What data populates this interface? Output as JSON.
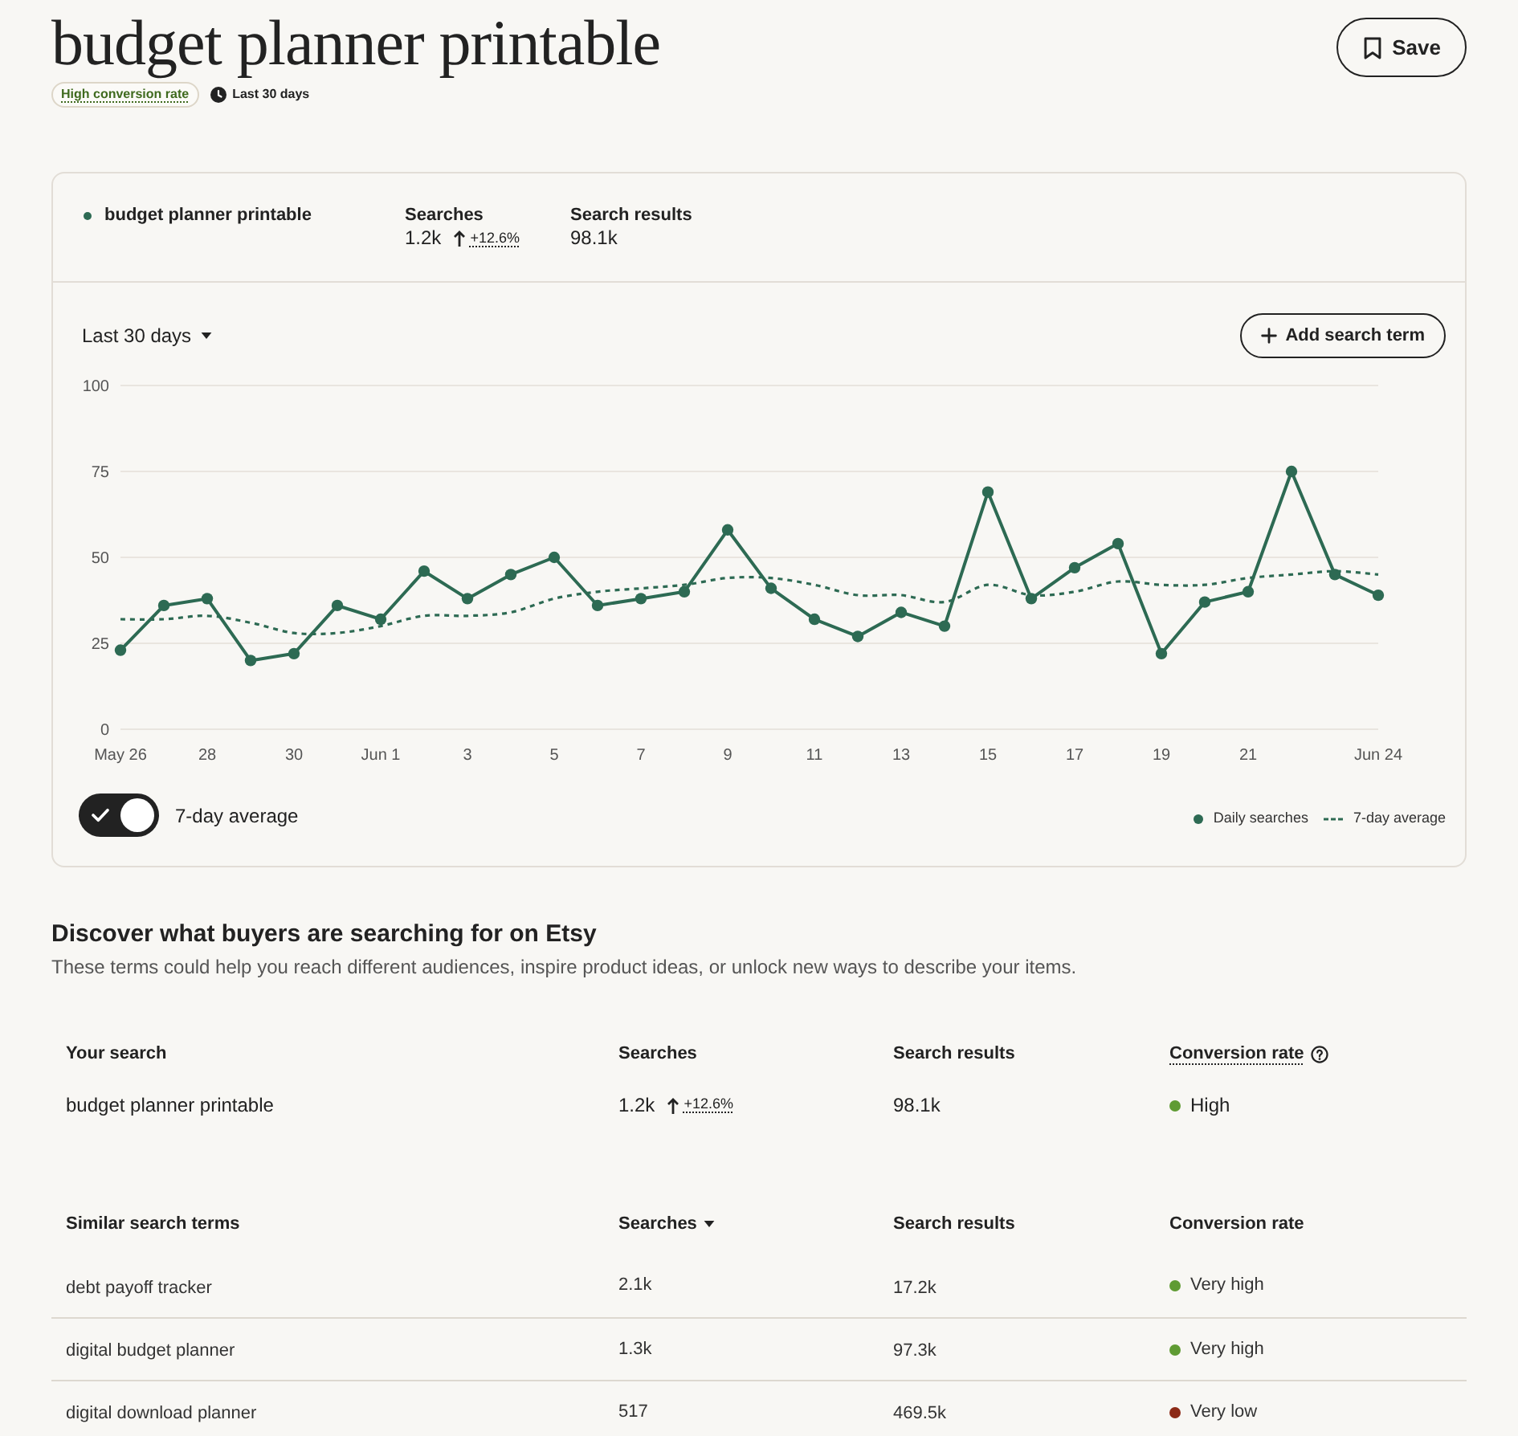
{
  "header": {
    "title": "budget planner printable",
    "badges": [
      {
        "kind": "conversion",
        "label": "High conversion rate"
      },
      {
        "kind": "period",
        "label": "Last 30 days"
      }
    ],
    "save_button": "Save"
  },
  "summary": {
    "term": "budget planner printable",
    "stats": [
      {
        "label": "Searches",
        "value": "1.2k",
        "change": "+12.6%"
      },
      {
        "label": "Search results",
        "value": "98.1k"
      }
    ]
  },
  "chart_controls": {
    "range": "Last 30 days",
    "add_button": "Add search term"
  },
  "chart_data": {
    "type": "line",
    "grid": true,
    "categories": [
      "May 26",
      null,
      "28",
      null,
      "30",
      null,
      "Jun 1",
      null,
      "3",
      null,
      "5",
      null,
      "7",
      null,
      "9",
      null,
      "11",
      null,
      "13",
      null,
      "15",
      null,
      "17",
      null,
      "19",
      null,
      "21",
      null,
      null,
      "Jun 24"
    ],
    "ylim": [
      0,
      100
    ],
    "yticks": [
      0,
      25,
      50,
      75,
      100
    ],
    "series": [
      {
        "name": "Daily searches",
        "color": "#2d6a53",
        "line_style": "solid",
        "marker": true,
        "values": [
          23,
          36,
          38,
          20,
          22,
          36,
          32,
          46,
          38,
          45,
          50,
          36,
          38,
          40,
          58,
          41,
          32,
          27,
          34,
          30,
          69,
          38,
          47,
          54,
          22,
          37,
          40,
          75,
          45,
          39
        ]
      },
      {
        "name": "7-day average",
        "color": "#2d6a53",
        "line_style": "dashed",
        "marker": false,
        "values": [
          32,
          32,
          33,
          31,
          28,
          28,
          30,
          33,
          33,
          34,
          38,
          40,
          41,
          42,
          44,
          44,
          42,
          39,
          39,
          37,
          42,
          39,
          40,
          43,
          42,
          42,
          44,
          45,
          46,
          45
        ]
      }
    ]
  },
  "average_toggle": {
    "label": "7-day average",
    "on": true
  },
  "discover": {
    "title": "Discover what buyers are searching for on Etsy",
    "description": "These terms could help you reach different audiences, inspire product ideas, or unlock new ways to describe your items."
  },
  "your_search": {
    "columns": [
      {
        "label": "Your search",
        "sorted": false,
        "help": false
      },
      {
        "label": "Searches",
        "sorted": false,
        "help": false
      },
      {
        "label": "Search results",
        "sorted": false,
        "help": false
      },
      {
        "label": "Conversion rate",
        "sorted": false,
        "help": true
      }
    ],
    "rows": [
      {
        "term": "budget planner printable",
        "searches": "1.2k",
        "change": "+12.6%",
        "results": "98.1k",
        "conversion": "High",
        "color": "#5f9b33"
      }
    ]
  },
  "similar_searches": {
    "columns": [
      {
        "label": "Similar search terms",
        "sorted": false,
        "help": false
      },
      {
        "label": "Searches",
        "sorted": true,
        "help": false
      },
      {
        "label": "Search results",
        "sorted": false,
        "help": false
      },
      {
        "label": "Conversion rate",
        "sorted": false,
        "help": false
      }
    ],
    "rows": [
      {
        "term": "debt payoff tracker",
        "searches": "2.1k",
        "results": "17.2k",
        "conversion": "Very high",
        "color": "#5f9b33"
      },
      {
        "term": "digital budget planner",
        "searches": "1.3k",
        "results": "97.3k",
        "conversion": "Very high",
        "color": "#5f9b33"
      },
      {
        "term": "digital download planner",
        "searches": "517",
        "results": "469.5k",
        "conversion": "Very low",
        "color": "#8c2a17"
      }
    ]
  }
}
